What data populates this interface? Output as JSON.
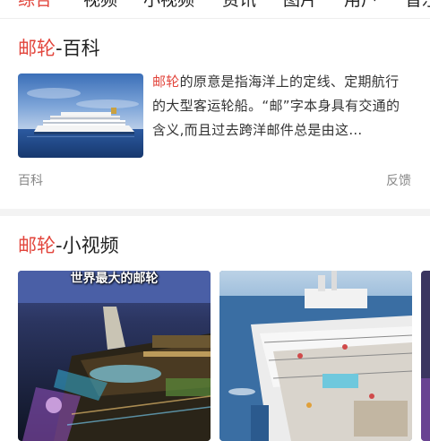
{
  "tabs": [
    {
      "label": "综合",
      "active": true
    },
    {
      "label": "视频",
      "active": false
    },
    {
      "label": "小视频",
      "active": false
    },
    {
      "label": "资讯",
      "active": false
    },
    {
      "label": "图片",
      "active": false
    },
    {
      "label": "用户",
      "active": false
    },
    {
      "label": "音乐",
      "active": false
    }
  ],
  "baike_card": {
    "title_keyword": "邮轮",
    "title_suffix": "-百科",
    "desc_keyword": "邮轮",
    "desc_rest": "的原意是指海洋上的定线、定期航行的大型客运轮船。“邮”字本身具有交通的含义,而且过去跨洋邮件总是由这…",
    "source": "百科",
    "feedback": "反馈"
  },
  "video_card": {
    "title_keyword": "邮轮",
    "title_suffix": "-小视频",
    "videos": [
      {
        "overlay_text": "世界最大的邮轮"
      },
      {
        "overlay_text": ""
      }
    ]
  },
  "colors": {
    "accent": "#e2453c",
    "divider": "#f3f3f3"
  }
}
